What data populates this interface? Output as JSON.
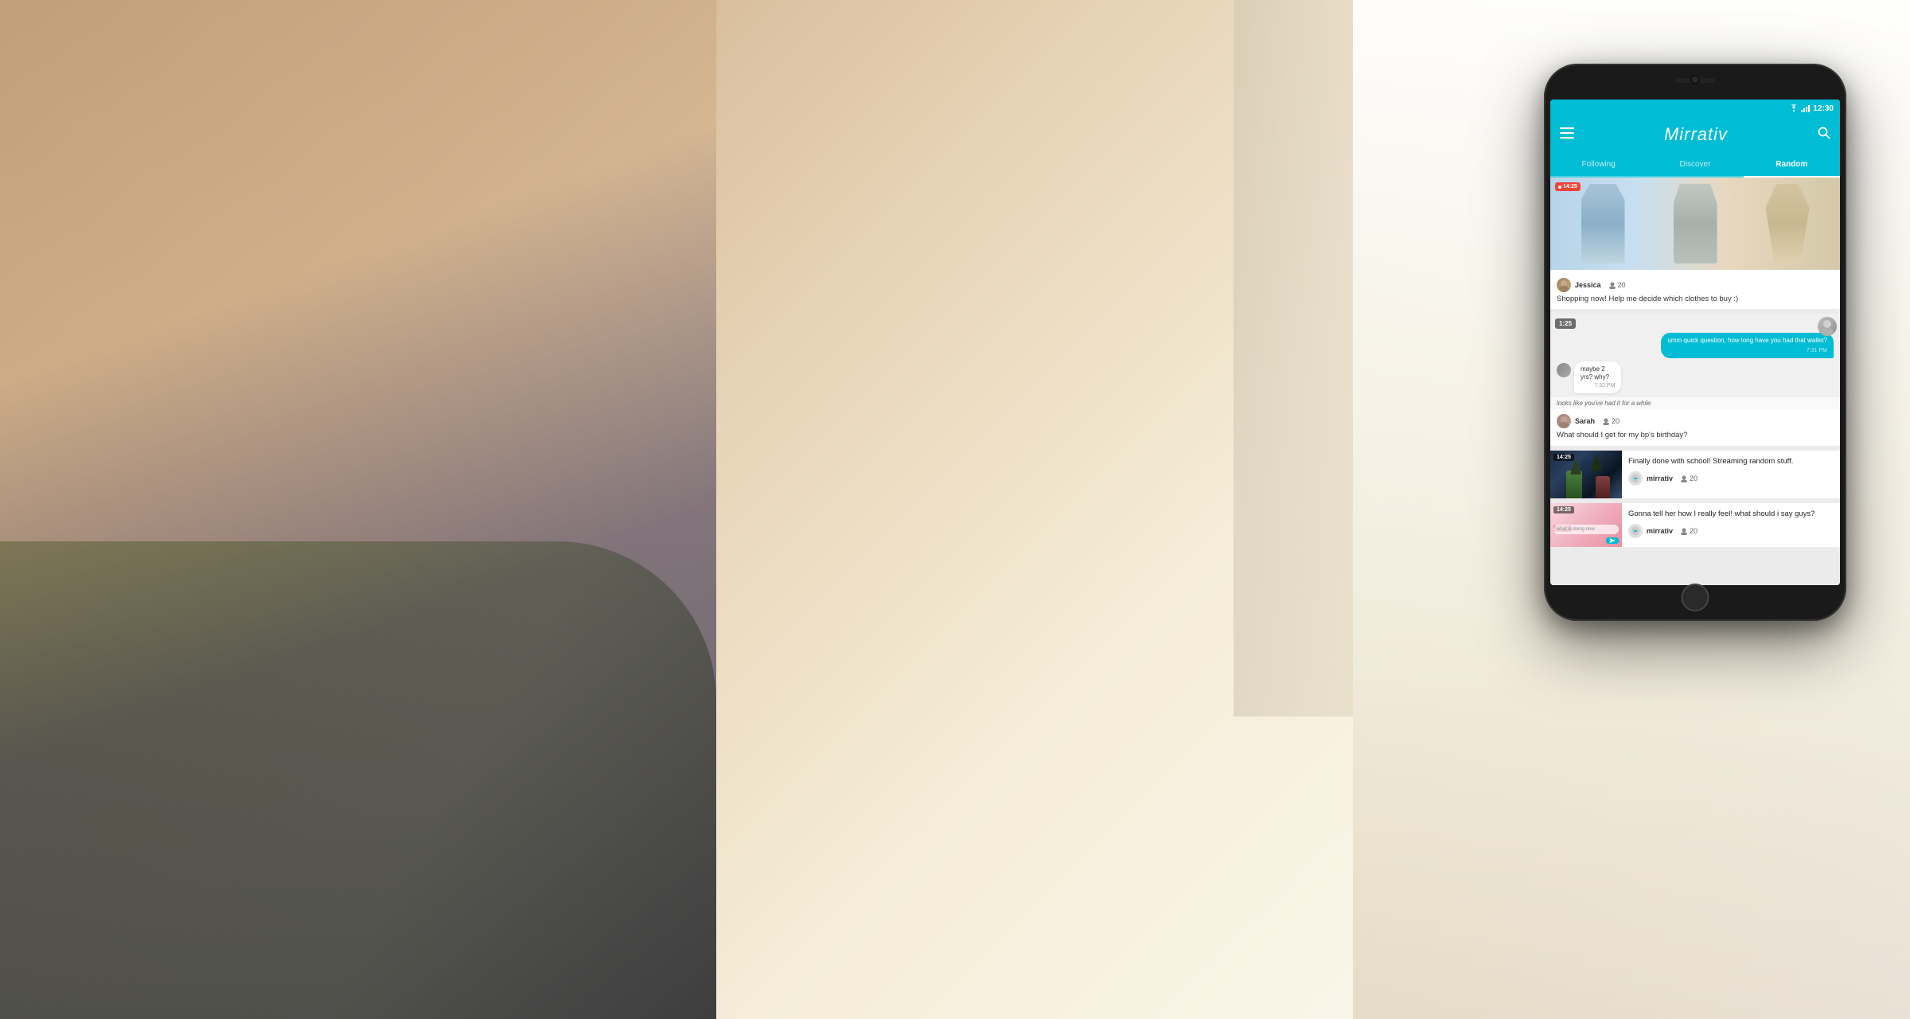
{
  "background": {
    "gradient_desc": "warm room background with sofa"
  },
  "phone": {
    "status_bar": {
      "time": "12:30",
      "wifi_icon": "wifi",
      "signal_icon": "signal",
      "battery_icon": "battery"
    },
    "header": {
      "menu_icon": "hamburger",
      "title": "Mirrativ",
      "search_icon": "search"
    },
    "tabs": [
      {
        "label": "Following",
        "active": false
      },
      {
        "label": "Discover",
        "active": false
      },
      {
        "label": "Random",
        "active": true
      }
    ],
    "streams": [
      {
        "id": "stream1",
        "timer": "14:25",
        "live": true,
        "thumbnail_type": "shopping",
        "username": "Jessica",
        "viewers": "20",
        "description": "Shopping now! Help me decide which clothes to buy :)"
      },
      {
        "id": "stream2",
        "timer": "1:25",
        "live": false,
        "thumbnail_type": "chat",
        "username": "Sarah",
        "viewers": "20",
        "description": "What should I get for my bp's birthday?",
        "chat_messages": [
          {
            "text": "umm quick question, how long have you  had that wallet?",
            "time": "7:31 PM",
            "side": "right"
          },
          {
            "text": "maybe 2 yrs? why?",
            "time": "7:32 PM",
            "side": "left"
          },
          {
            "overlay": "looks like you've had it for a while"
          }
        ]
      },
      {
        "id": "stream3",
        "timer": "14:25",
        "live": false,
        "thumbnail_type": "game",
        "username": "mirrativ",
        "viewers": "20",
        "description": "Finally done with school! Streaming random stuff."
      },
      {
        "id": "stream4",
        "timer": "14:25",
        "live": false,
        "thumbnail_type": "pink",
        "username": "mirrativ",
        "viewers": "20",
        "description": "Gonna tell her how I really feel! what should i say guys?",
        "pink_label": "hello-",
        "pink_sublabel": "what is doing now"
      }
    ]
  }
}
